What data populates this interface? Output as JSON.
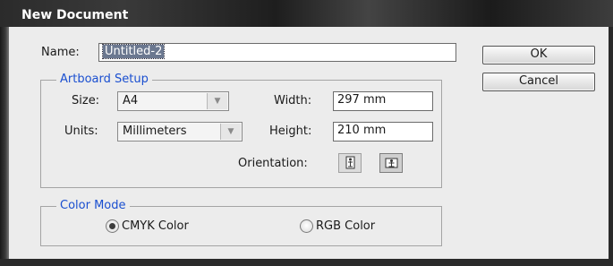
{
  "window": {
    "title": "New Document"
  },
  "name_field": {
    "label": "Name:",
    "value": "Untitled-2"
  },
  "artboard": {
    "legend": "Artboard Setup",
    "size": {
      "label": "Size:",
      "value": "A4"
    },
    "units": {
      "label": "Units:",
      "value": "Millimeters"
    },
    "width": {
      "label": "Width:",
      "value": "297 mm"
    },
    "height": {
      "label": "Height:",
      "value": "210 mm"
    },
    "orientation": {
      "label": "Orientation:",
      "selected": "landscape"
    }
  },
  "color_mode": {
    "legend": "Color Mode",
    "options": [
      {
        "label": "CMYK Color",
        "selected": true
      },
      {
        "label": "RGB Color",
        "selected": false
      }
    ]
  },
  "buttons": {
    "ok": "OK",
    "cancel": "Cancel"
  },
  "colors": {
    "accent_label": "#1a4fd0",
    "dialog_bg": "#ececec",
    "selection": "#6b7890"
  },
  "icons": {
    "dropdown_arrow": "triangle-down",
    "portrait": "portrait-orientation-icon",
    "landscape": "landscape-orientation-icon"
  }
}
